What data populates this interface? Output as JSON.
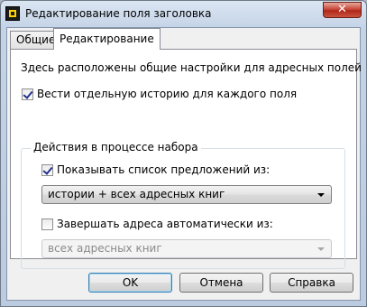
{
  "window": {
    "title": "Редактирование поля заголовка",
    "close_glyph": "✕"
  },
  "tabs": [
    {
      "label": "Общие",
      "active": false
    },
    {
      "label": "Редактирование",
      "active": true
    }
  ],
  "panel": {
    "description": "Здесь расположены общие настройки для адресных полей",
    "separate_history": {
      "label": "Вести отдельную историю для каждого поля",
      "checked": true
    },
    "group": {
      "title": "Действия в процессе набора",
      "show_suggestions": {
        "label": "Показывать список предложений из:",
        "checked": true,
        "selected": "истории + всех адресных книг"
      },
      "autocomplete": {
        "label": "Завершать адреса автоматически из:",
        "checked": false,
        "selected": "всех адресных книг",
        "disabled": true
      }
    }
  },
  "buttons": {
    "ok": "OK",
    "cancel": "Отмена",
    "help": "Справка"
  },
  "icons": {
    "app": "app-icon",
    "close": "close-icon",
    "dropdown": "chevron-down-icon",
    "check": "check-icon"
  }
}
